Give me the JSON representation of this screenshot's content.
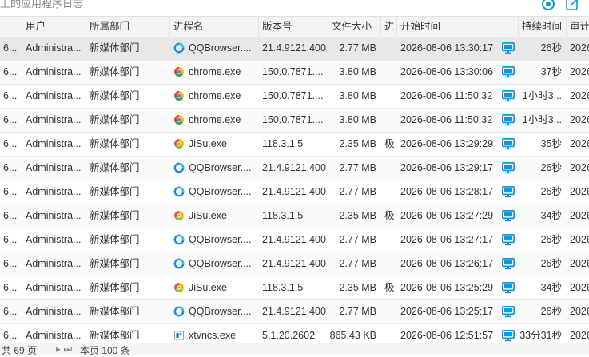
{
  "window_title": "上的应用程序日志",
  "columns": {
    "c0": "",
    "user": "用户",
    "dept": "所属部门",
    "process": "进程名",
    "version": "版本号",
    "size": "文件大小",
    "proc_short": "进",
    "start": "开始时间",
    "duration": "持续时间",
    "audit": "审计"
  },
  "rows": [
    {
      "id": "6...",
      "user": "Administra...",
      "dept": "新媒体部门",
      "process": "QQBrowser....",
      "icon": "qqbrowser",
      "version": "21.4.9121.400",
      "size": "2.77 MB",
      "p": "",
      "start": "2026-08-06 13:30:17",
      "duration": "26秒",
      "audit": "2026"
    },
    {
      "id": "6...",
      "user": "Administra...",
      "dept": "新媒体部门",
      "process": "chrome.exe",
      "icon": "chrome",
      "version": "150.0.7871....",
      "size": "3.80 MB",
      "p": "",
      "start": "2026-08-06 13:30:06",
      "duration": "37秒",
      "audit": "2026"
    },
    {
      "id": "6...",
      "user": "Administra...",
      "dept": "新媒体部门",
      "process": "chrome.exe",
      "icon": "chrome",
      "version": "150.0.7871....",
      "size": "3.80 MB",
      "p": "",
      "start": "2026-08-06 11:50:32",
      "duration": "1小时3...",
      "audit": "2026"
    },
    {
      "id": "6...",
      "user": "Administra...",
      "dept": "新媒体部门",
      "process": "chrome.exe",
      "icon": "chrome",
      "version": "150.0.7871....",
      "size": "3.80 MB",
      "p": "",
      "start": "2026-08-06 11:50:32",
      "duration": "1小时3...",
      "audit": "2026"
    },
    {
      "id": "6...",
      "user": "Administra...",
      "dept": "新媒体部门",
      "process": "JiSu.exe",
      "icon": "jisu",
      "version": "118.3.1.5",
      "size": "2.35 MB",
      "p": "极",
      "start": "2026-08-06 13:29:29",
      "duration": "35秒",
      "audit": "2026"
    },
    {
      "id": "6...",
      "user": "Administra...",
      "dept": "新媒体部门",
      "process": "QQBrowser....",
      "icon": "qqbrowser",
      "version": "21.4.9121.400",
      "size": "2.77 MB",
      "p": "",
      "start": "2026-08-06 13:29:17",
      "duration": "26秒",
      "audit": "2026"
    },
    {
      "id": "6...",
      "user": "Administra...",
      "dept": "新媒体部门",
      "process": "QQBrowser....",
      "icon": "qqbrowser",
      "version": "21.4.9121.400",
      "size": "2.77 MB",
      "p": "",
      "start": "2026-08-06 13:28:17",
      "duration": "26秒",
      "audit": "2026"
    },
    {
      "id": "6...",
      "user": "Administra...",
      "dept": "新媒体部门",
      "process": "JiSu.exe",
      "icon": "jisu",
      "version": "118.3.1.5",
      "size": "2.35 MB",
      "p": "极",
      "start": "2026-08-06 13:27:29",
      "duration": "34秒",
      "audit": "2026"
    },
    {
      "id": "6...",
      "user": "Administra...",
      "dept": "新媒体部门",
      "process": "QQBrowser....",
      "icon": "qqbrowser",
      "version": "21.4.9121.400",
      "size": "2.77 MB",
      "p": "",
      "start": "2026-08-06 13:27:17",
      "duration": "26秒",
      "audit": "2026"
    },
    {
      "id": "6...",
      "user": "Administra...",
      "dept": "新媒体部门",
      "process": "QQBrowser....",
      "icon": "qqbrowser",
      "version": "21.4.9121.400",
      "size": "2.77 MB",
      "p": "",
      "start": "2026-08-06 13:26:17",
      "duration": "26秒",
      "audit": "2026"
    },
    {
      "id": "6...",
      "user": "Administra...",
      "dept": "新媒体部门",
      "process": "JiSu.exe",
      "icon": "jisu",
      "version": "118.3.1.5",
      "size": "2.35 MB",
      "p": "极",
      "start": "2026-08-06 13:25:29",
      "duration": "34秒",
      "audit": "2026"
    },
    {
      "id": "6...",
      "user": "Administra...",
      "dept": "新媒体部门",
      "process": "QQBrowser....",
      "icon": "qqbrowser",
      "version": "21.4.9121.400",
      "size": "2.77 MB",
      "p": "",
      "start": "2026-08-06 13:25:17",
      "duration": "26秒",
      "audit": "2026"
    },
    {
      "id": "6...",
      "user": "Administra...",
      "dept": "新媒体部门",
      "process": "xtvncs.exe",
      "icon": "xtvncs",
      "version": "5.1.20.2602",
      "size": "865.43 KB",
      "p": "",
      "start": "2026-08-06 12:51:57",
      "duration": "33分31秒",
      "audit": "2026"
    }
  ],
  "footer": {
    "total": "共 69 页",
    "page": "本页 100 条"
  },
  "colors": {
    "header_bg": "#f2f3f5",
    "selected_row": "#e8e8e8",
    "monitor_blue": "#1296db",
    "chrome_red": "#ea4335",
    "chrome_yellow": "#fbbc05",
    "chrome_green": "#34a853",
    "chrome_blue": "#4285f4"
  }
}
